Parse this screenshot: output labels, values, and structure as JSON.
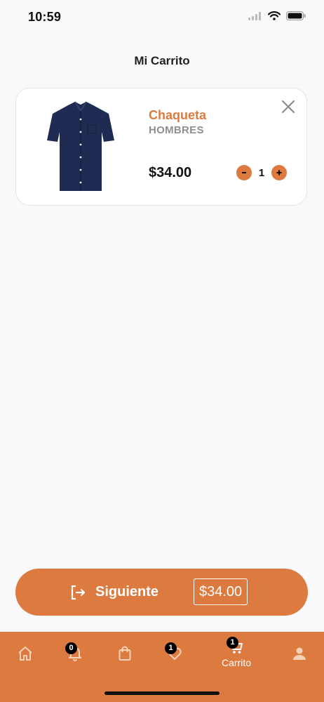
{
  "status_bar": {
    "time": "10:59"
  },
  "header": {
    "title": "Mi Carrito"
  },
  "cart": {
    "items": [
      {
        "name": "Chaqueta",
        "category": "HOMBRES",
        "price": "$34.00",
        "quantity": "1",
        "image_icon": "shirt-icon"
      }
    ]
  },
  "checkout": {
    "label": "Siguiente",
    "total": "$34.00",
    "icon": "exit-arrow-icon"
  },
  "tab_bar": {
    "items": [
      {
        "icon": "home-icon",
        "label": ""
      },
      {
        "icon": "bell-icon",
        "badge": "0"
      },
      {
        "icon": "shopping-bag-icon"
      },
      {
        "icon": "heart-icon",
        "badge": "1"
      },
      {
        "icon": "cart-icon",
        "badge": "1",
        "label": "Carrito",
        "active": true
      },
      {
        "icon": "user-icon"
      }
    ]
  },
  "colors": {
    "accent": "#dc7a40",
    "background": "#f9f8fb",
    "muted_text": "#8e8e8e"
  }
}
